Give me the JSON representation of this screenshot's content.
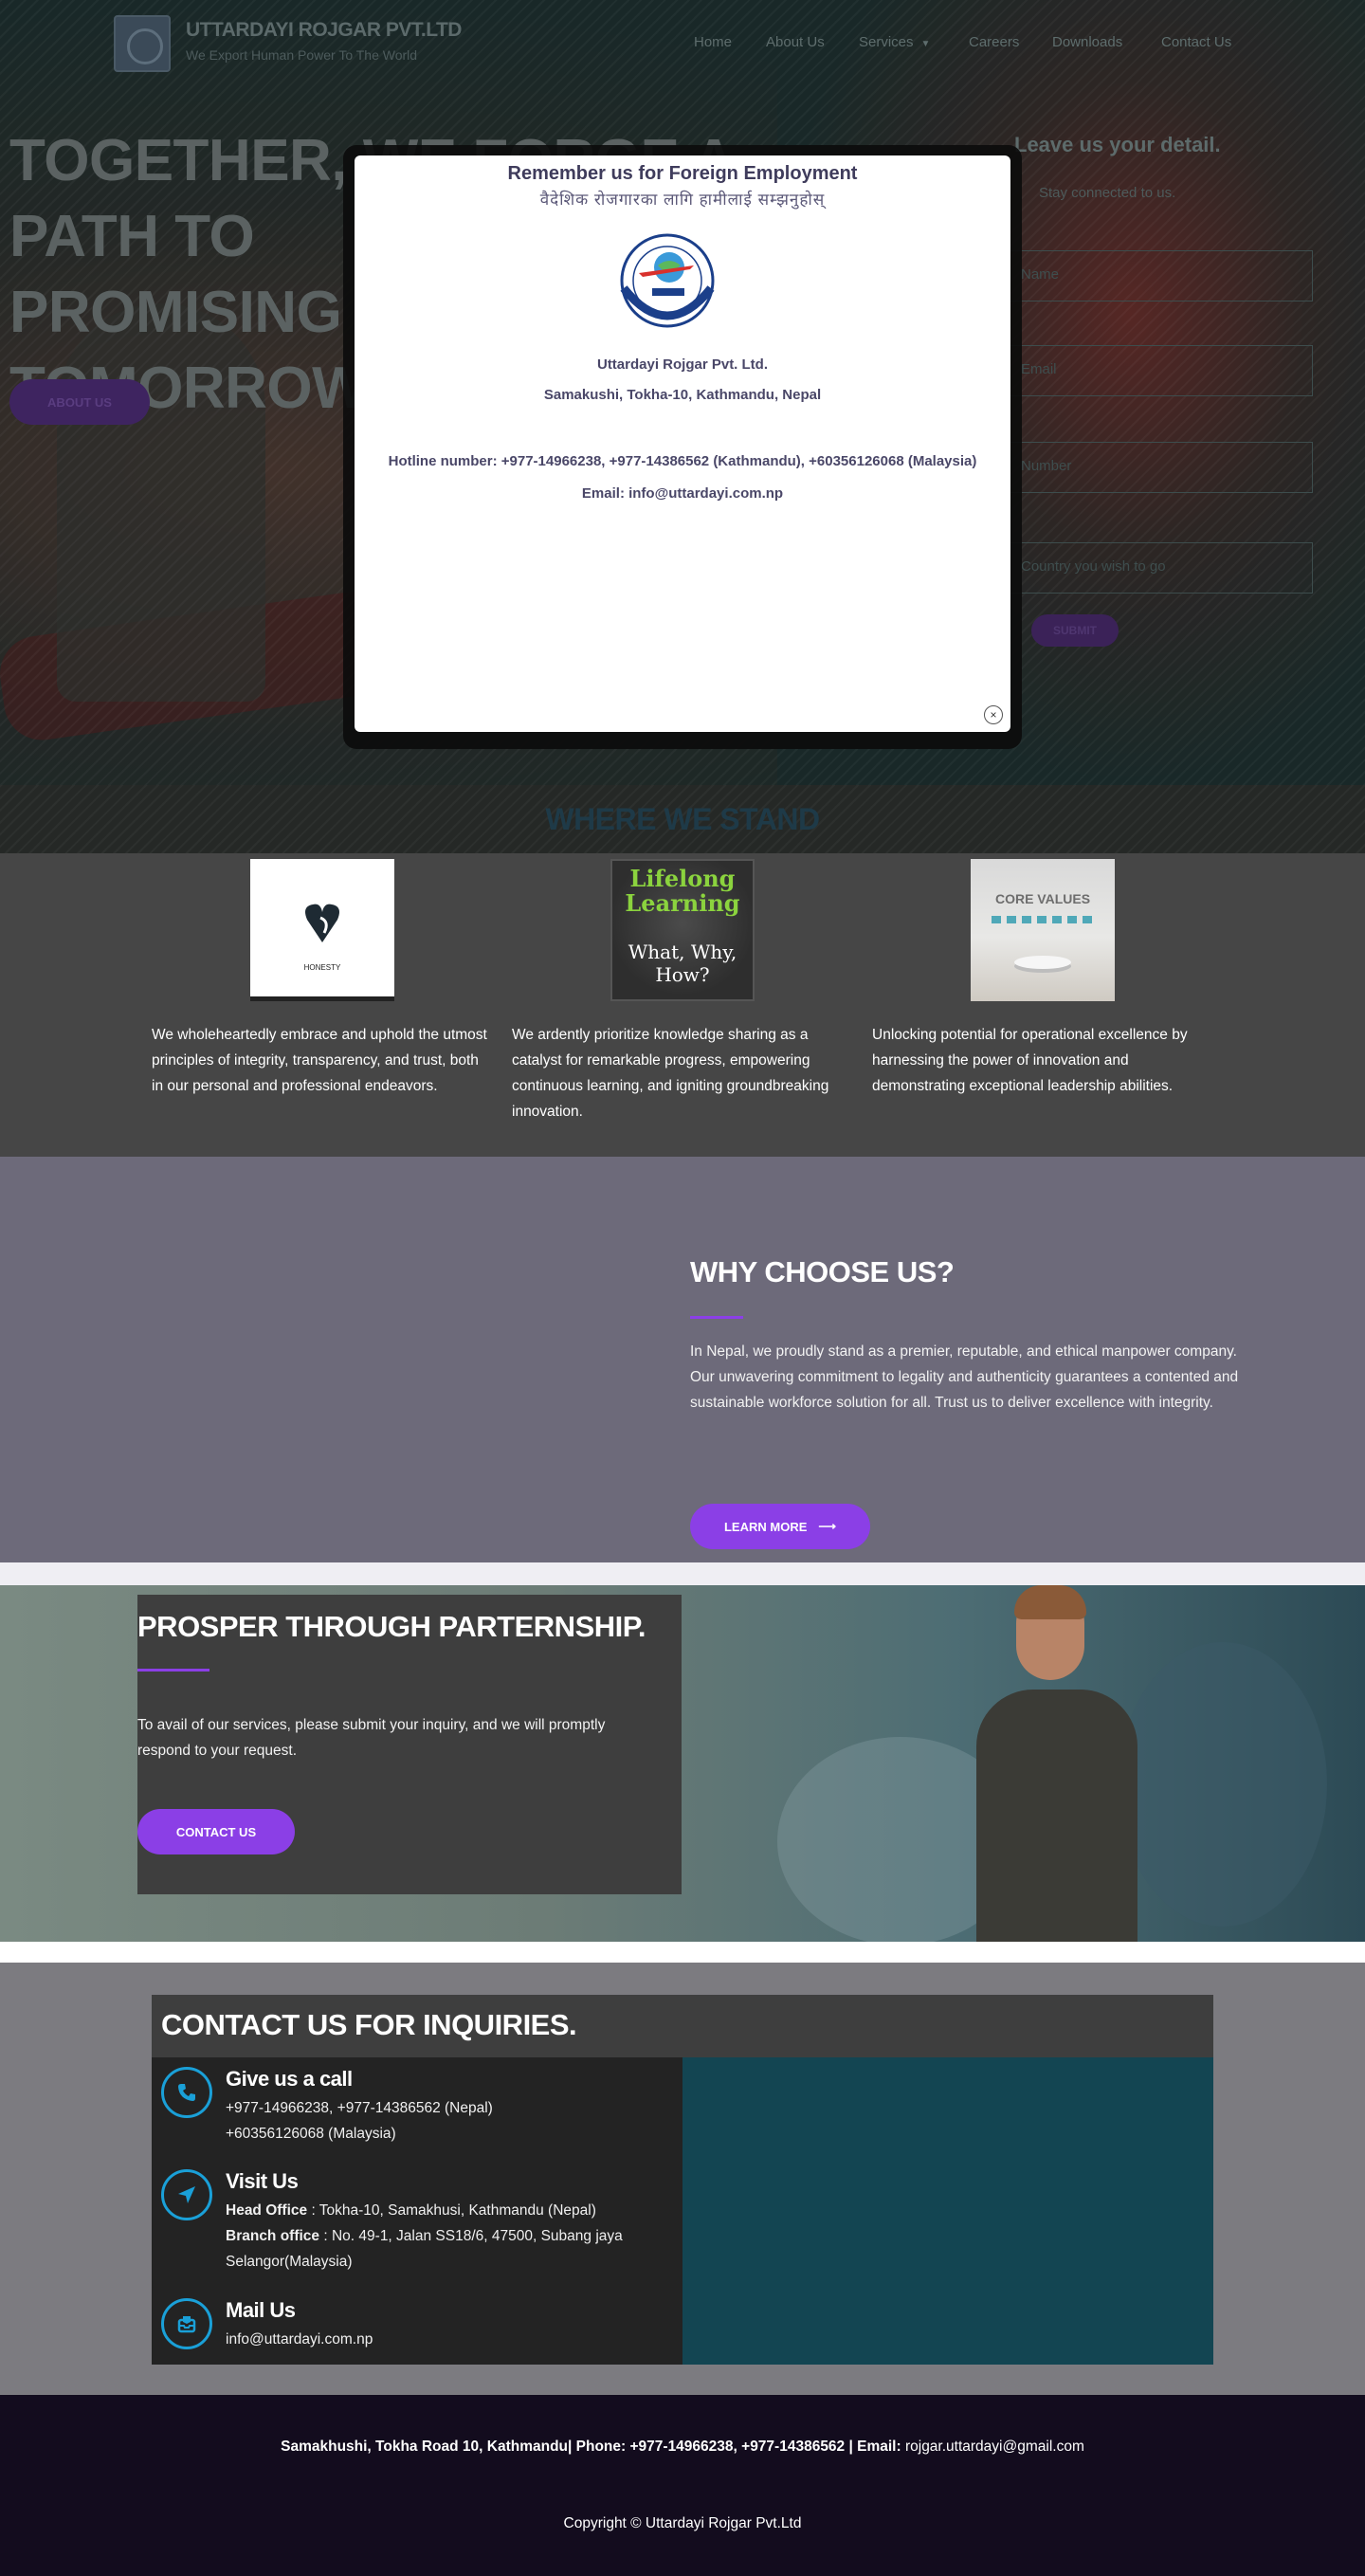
{
  "header": {
    "brand_name": "UTTARDAYI ROJGAR PVT.LTD",
    "tagline": "We Export Human Power To The World",
    "nav": {
      "home": "Home",
      "about": "About Us",
      "services": "Services",
      "careers": "Careers",
      "downloads": "Downloads",
      "contact": "Contact Us"
    }
  },
  "hero": {
    "title_line1": "TOGETHER, WE FORGE A PATH TO",
    "title_line2": "PROMISING A",
    "title_line3": "TOMORROW.",
    "about_button": "ABOUT US"
  },
  "lead_form": {
    "title": "Leave us your detail.",
    "subtitle": "Stay connected to us.",
    "field_name_placeholder": "Name",
    "field_email_placeholder": "Email",
    "field_phone_placeholder": "Number",
    "field_country_placeholder": "Country you wish to go",
    "submit_label": "SUBMIT"
  },
  "modal": {
    "title": "Remember us for Foreign Employment",
    "nepali_line": "वैदेशिक रोजगारका लागि हामीलाई सम्झनुहोस्",
    "company": "Uttardayi Rojgar Pvt. Ltd.",
    "address": "Samakushi, Tokha-10, Kathmandu, Nepal",
    "hotline": "Hotline number: +977-14966238, +977-14386562 (Kathmandu),  +60356126068 (Malaysia)",
    "email": "Email: info@uttardayi.com.np",
    "close_label": "×",
    "logo_text": "UTTARDAYI ROJGAR Pvt. Ltd."
  },
  "stand": {
    "title": "WHERE WE STAND",
    "items": [
      {
        "image_caption": "HONESTY",
        "text": "We wholeheartedly embrace and uphold the utmost principles of integrity, transparency, and trust, both in our personal and professional endeavors."
      },
      {
        "image_title": "Lifelong Learning",
        "image_subtitle": "What, Why, How?",
        "text": "We ardently prioritize knowledge sharing as a catalyst for remarkable progress, empowering continuous learning, and igniting groundbreaking innovation."
      },
      {
        "image_title": "CORE VALUES",
        "text": "Unlocking potential for operational excellence by harnessing the power of innovation and demonstrating exceptional leadership abilities."
      }
    ]
  },
  "why": {
    "title": "WHY CHOOSE US?",
    "text": "In Nepal, we proudly stand as a premier, reputable, and ethical manpower company. Our unwavering commitment to legality and authenticity guarantees a contented and sustainable workforce solution for all. Trust us to deliver excellence with integrity.",
    "button": "LEARN MORE"
  },
  "prosper": {
    "title": "PROSPER THROUGH PARTERNSHIP.",
    "text": "To avail of our services, please submit your inquiry, and we will promptly respond to your request.",
    "button": "CONTACT US"
  },
  "contact": {
    "title": "CONTACT US FOR INQUIRIES.",
    "call": {
      "heading": "Give us a call",
      "line1": "+977-14966238, +977-14386562 (Nepal)",
      "line2": "+60356126068 (Malaysia)"
    },
    "visit": {
      "heading": "Visit Us",
      "head_label": "Head Office",
      "head_value": " : Tokha-10, Samakhusi, Kathmandu (Nepal)",
      "branch_label": "Branch office",
      "branch_value": ": No. 49-1, Jalan SS18/6, 47500, Subang jaya Selangor(Malaysia)"
    },
    "mail": {
      "heading": "Mail Us",
      "line1": "info@uttardayi.com.np"
    }
  },
  "footer": {
    "address": "Samakhushi, Tokha Road 10, Kathmandu",
    "phone_label": "| Phone: +977-14966238, +977-14386562",
    "email_label": " | Email:",
    "email_value": " rojgar.uttardayi@gmail.com",
    "copyright": "Copyright © Uttardayi Rojgar Pvt.Ltd"
  },
  "colors": {
    "accent": "#8b3fe6",
    "icon_blue": "#1aa0d8",
    "footer_bg": "#130c1e"
  }
}
